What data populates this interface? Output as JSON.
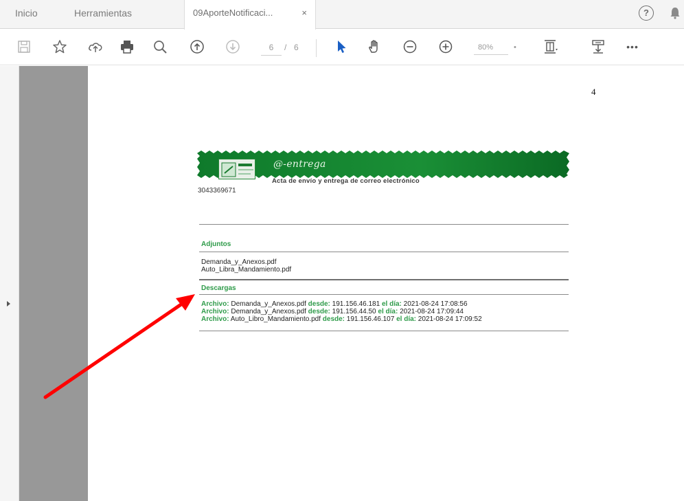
{
  "tabs": {
    "inicio": "Inicio",
    "herramientas": "Herramientas",
    "document": "09AporteNotificaci...",
    "close_glyph": "×"
  },
  "toolbar": {
    "page_current": "6",
    "page_sep": "/",
    "page_total": "6",
    "zoom": "80%",
    "zoom_caret": "•",
    "more": "•••",
    "icons": [
      "save-icon",
      "star-icon",
      "upload-icon",
      "print-icon",
      "search-icon",
      "page-up-icon",
      "page-down-icon",
      "select-cursor-icon",
      "hand-icon",
      "zoom-out-icon",
      "zoom-in-icon",
      "fit-page-icon",
      "annotate-icon",
      "more-icon"
    ]
  },
  "help": "?",
  "document": {
    "page_number": "4",
    "banner_logo": "@-entrega",
    "banner_subtitle": "Acta de envío y entrega de correo electrónico",
    "ref_number": "3043369671",
    "adjuntos": {
      "title": "Adjuntos",
      "files": [
        "Demanda_y_Anexos.pdf",
        "Auto_Libra_Mandamiento.pdf"
      ]
    },
    "descargas": {
      "title": "Descargas",
      "rows": [
        {
          "label": "Archivo:",
          "file": "Demanda_y_Anexos.pdf",
          "desde_label": "desde:",
          "ip": "191.156.46.181",
          "dia_label": "el día:",
          "date": "2021-08-24 17:08:56"
        },
        {
          "label": "Archivo:",
          "file": "Demanda_y_Anexos.pdf",
          "desde_label": "desde:",
          "ip": "191.156.44.50",
          "dia_label": "el día:",
          "date": "2021-08-24 17:09:44"
        },
        {
          "label": "Archivo:",
          "file": "Auto_Libro_Mandamiento.pdf",
          "desde_label": "desde:",
          "ip": "191.156.46.107",
          "dia_label": "el día:",
          "date": "2021-08-24 17:09:52"
        }
      ]
    }
  },
  "colors": {
    "accent_green": "#2f9b4a",
    "banner_green": "#0f7a2b",
    "annotation_arrow": "#ff0000",
    "cursor_blue": "#1a5fc4"
  }
}
